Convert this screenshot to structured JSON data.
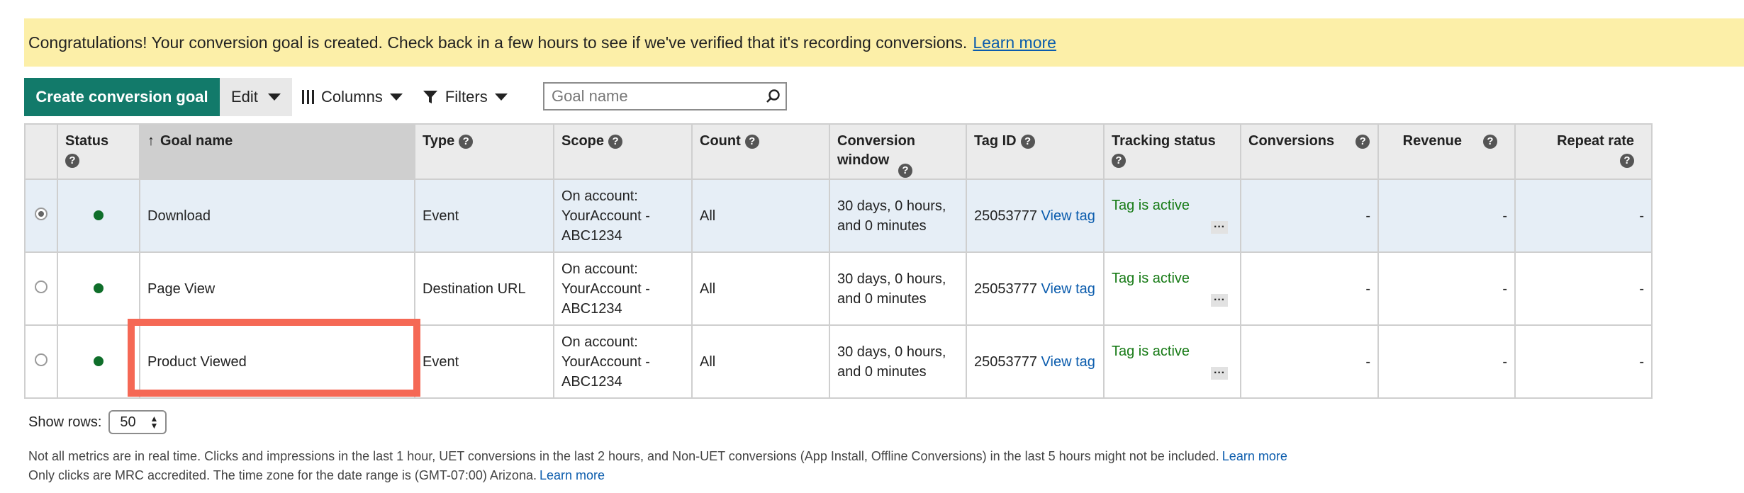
{
  "banner": {
    "message": "Congratulations! Your conversion goal is created. Check back in a few hours to see if we've verified that it's recording conversions.",
    "link": "Learn more"
  },
  "toolbar": {
    "create_label": "Create conversion goal",
    "edit_label": "Edit",
    "columns_label": "Columns",
    "filters_label": "Filters",
    "search_placeholder": "Goal name"
  },
  "table": {
    "headers": {
      "status": "Status",
      "goal_name": "Goal name",
      "type": "Type",
      "scope": "Scope",
      "count": "Count",
      "conversion_window": "Conversion window",
      "tag_id": "Tag ID",
      "tracking_status": "Tracking status",
      "conversions": "Conversions",
      "revenue": "Revenue",
      "repeat_rate": "Repeat rate"
    },
    "rows": [
      {
        "selected": true,
        "name": "Download",
        "type": "Event",
        "scope_line1": "On account:",
        "scope_line2": "YourAccount -",
        "scope_line3": "ABC1234",
        "count": "All",
        "window_line1": "30 days, 0 hours,",
        "window_line2": "and 0 minutes",
        "tag_id": "25053777",
        "view_tag": "View tag",
        "tracking": "Tag is active",
        "conversions": "-",
        "revenue": "-",
        "repeat_rate": "-"
      },
      {
        "selected": false,
        "name": "Page View",
        "type": "Destination URL",
        "scope_line1": "On account:",
        "scope_line2": "YourAccount -",
        "scope_line3": "ABC1234",
        "count": "All",
        "window_line1": "30 days, 0 hours,",
        "window_line2": "and 0 minutes",
        "tag_id": "25053777",
        "view_tag": "View tag",
        "tracking": "Tag is active",
        "conversions": "-",
        "revenue": "-",
        "repeat_rate": "-"
      },
      {
        "selected": false,
        "name": "Product Viewed",
        "type": "Event",
        "scope_line1": "On account:",
        "scope_line2": "YourAccount -",
        "scope_line3": "ABC1234",
        "count": "All",
        "window_line1": "30 days, 0 hours,",
        "window_line2": "and 0 minutes",
        "tag_id": "25053777",
        "view_tag": "View tag",
        "tracking": "Tag is active",
        "conversions": "-",
        "revenue": "-",
        "repeat_rate": "-"
      }
    ]
  },
  "footer": {
    "show_rows_label": "Show rows:",
    "rows_value": "50",
    "note1": "Not all metrics are in real time. Clicks and impressions in the last 1 hour, UET conversions in the last 2 hours, and Non-UET conversions (App Install, Offline Conversions) in the last 5 hours might not be included.",
    "note1_link": "Learn more",
    "note2": "Only clicks are MRC accredited. The time zone for the date range is (GMT-07:00) Arizona.",
    "note2_link": "Learn more"
  },
  "colors": {
    "create_button": "#127a6a",
    "banner_bg": "#fcefa8",
    "status_active": "#167a15",
    "link": "#0b5cad",
    "highlight_box": "#f56855"
  },
  "icons": [
    "columns-icon",
    "filter-icon",
    "search-icon",
    "sort-up-icon",
    "help-icon",
    "status-dot-icon",
    "more-icon",
    "caret-down-icon"
  ]
}
